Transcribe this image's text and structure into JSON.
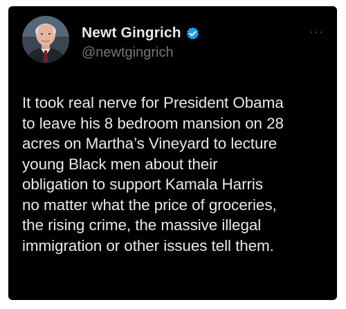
{
  "author": {
    "display_name": "Newt Gingrich",
    "handle": "@newtgingrich",
    "verified_icon": "verified-badge-icon",
    "avatar_icon": "profile-photo"
  },
  "post": {
    "text": "It took real nerve for President Obama\nto leave his 8 bedroom mansion on 28\nacres on Martha’s Vineyard to lecture\nyoung Black men about their\nobligation to support Kamala Harris\nno matter what the price of groceries,\nthe rising crime, the massive illegal\nimmigration or other issues tell them."
  },
  "menu": {
    "more_label": "···"
  },
  "colors": {
    "background": "#000000",
    "text": "#e7e9ea",
    "secondary_text": "#71767b",
    "verified_blue": "#1d9bf0"
  }
}
